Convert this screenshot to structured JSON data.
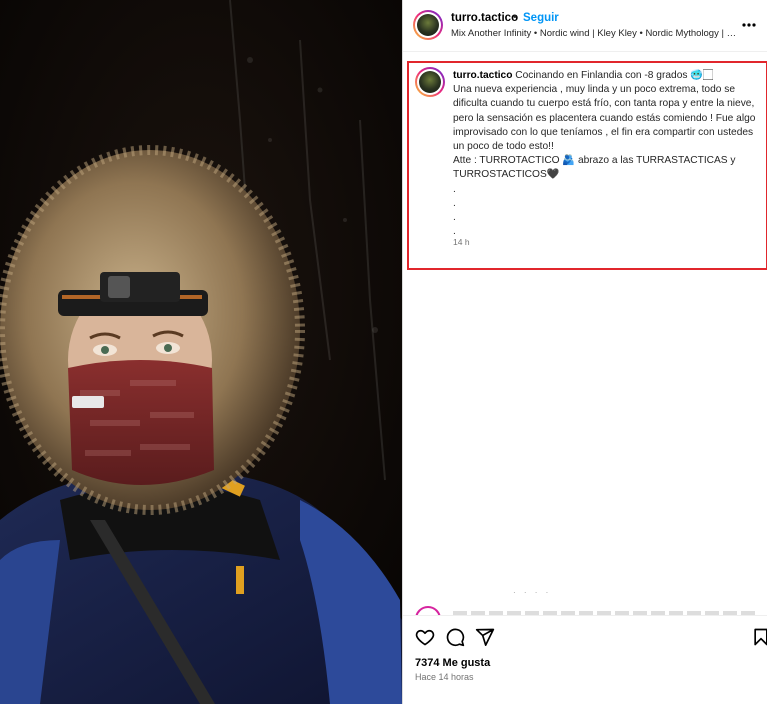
{
  "post": {
    "username": "turro.tactico",
    "separator": "•",
    "follow_label": "Seguir",
    "audio": "Mix Another Infinity • Nordic wind | Kley Kley • Nordic Mythology | DJ...",
    "more_icon": "more-options-icon",
    "more_label": "..."
  },
  "caption": {
    "username": "turro.tactico",
    "title": "Cocinando en Finlandia con -8 grados 🥶🏻",
    "lines": [
      "Una nueva experiencia , muy linda y un poco extrema, todo se",
      "dificulta cuando tu cuerpo está frío, con tanta ropa y entre la nieve,",
      "pero la sensación es placentera cuando estás comiendo ! Fue algo",
      "improvisado con lo que teníamos , el fin era compartir con ustedes",
      "un poco de todo esto!!",
      "Atte : TURROTACTICO 🫂 abrazo a las TURRASTACTICAS y",
      "TURROSTACTICOS🖤",
      ".",
      ".",
      ".",
      "."
    ],
    "time": "14 h"
  },
  "actions": {
    "like_icon": "heart-icon",
    "comment_icon": "comment-icon",
    "share_icon": "share-icon",
    "save_icon": "bookmark-icon",
    "likes": "7374 Me gusta",
    "ago": "Hace 14 horas"
  },
  "colors": {
    "accent": "#0095f6",
    "highlight_box": "#e1262c",
    "text": "#262626",
    "muted": "#737373"
  }
}
